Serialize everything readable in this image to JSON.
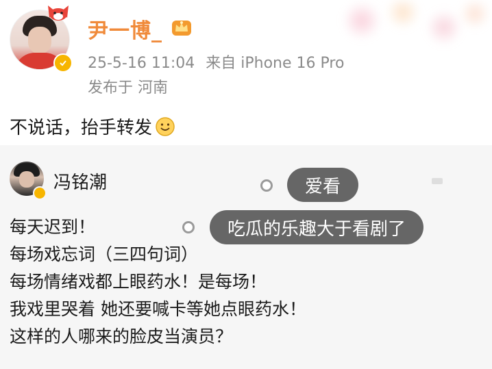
{
  "post": {
    "author": "尹一博_",
    "timestamp": "25-5-16 11:04",
    "source": "来自 iPhone 16 Pro",
    "location": "发布于 河南",
    "text": "不说话，抬手转发"
  },
  "repost": {
    "author": "冯铭潮",
    "lines": [
      "每天迟到！",
      "每场戏忘词（三四句词）",
      "每场情绪戏都上眼药水！是每场！",
      "我戏里哭着 她还要喊卡等她点眼药水！",
      "这样的人哪来的脸皮当演员？"
    ]
  },
  "danmaku": [
    {
      "text": "爱看"
    },
    {
      "text": "吃瓜的乐趣大于看剧了"
    }
  ],
  "colors": {
    "username": "#f08a3a",
    "meta": "#8a8a8a",
    "repost_bg": "#f6f6f6",
    "bubble_bg": "#525252",
    "verified": "#f7b500"
  },
  "icons": {
    "avatar_decoration": "fox-icon",
    "member_badge": "crown-icon",
    "verified": "verified-badge-icon",
    "emoji": "smile-icon"
  }
}
